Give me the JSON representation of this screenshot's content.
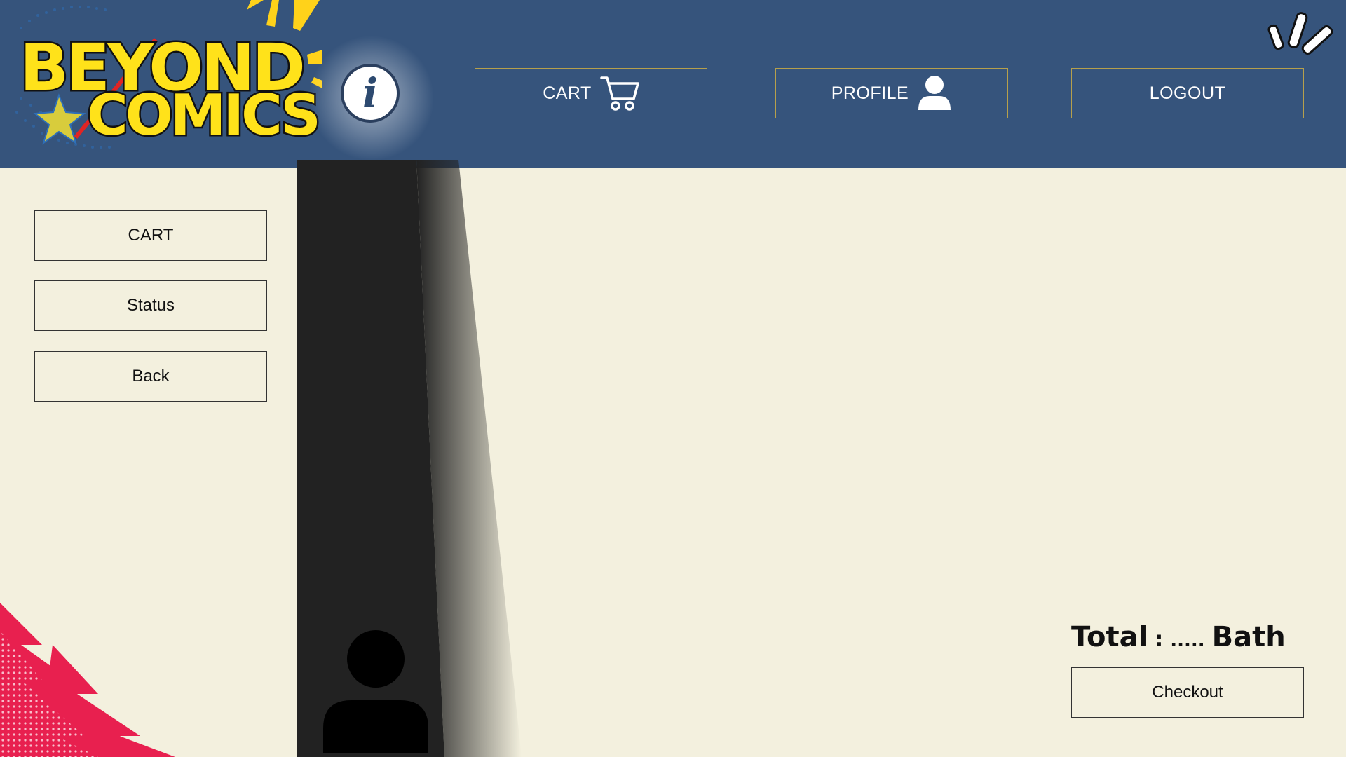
{
  "brand": {
    "logo_line1": "BEYOND",
    "logo_line2": "COMICS",
    "info_symbol": "i"
  },
  "header_nav": {
    "cart_label": "CART",
    "cart_icon": "cart-icon",
    "profile_label": "PROFILE",
    "profile_icon": "user-icon",
    "logout_label": "LOGOUT"
  },
  "sidebar": {
    "items": [
      {
        "label": "CART"
      },
      {
        "label": "Status"
      },
      {
        "label": "Back"
      }
    ]
  },
  "summary": {
    "total_label": "Total",
    "separator": ":",
    "total_value": ".....",
    "currency": "Bath",
    "checkout_label": "Checkout"
  },
  "colors": {
    "header_bg": "#36547c",
    "page_bg": "#f3f0de",
    "button_border_header": "#b6a04c",
    "logo_yellow": "#ffe21a",
    "accent_pink": "#e8204f",
    "panel_dark": "#222222"
  }
}
